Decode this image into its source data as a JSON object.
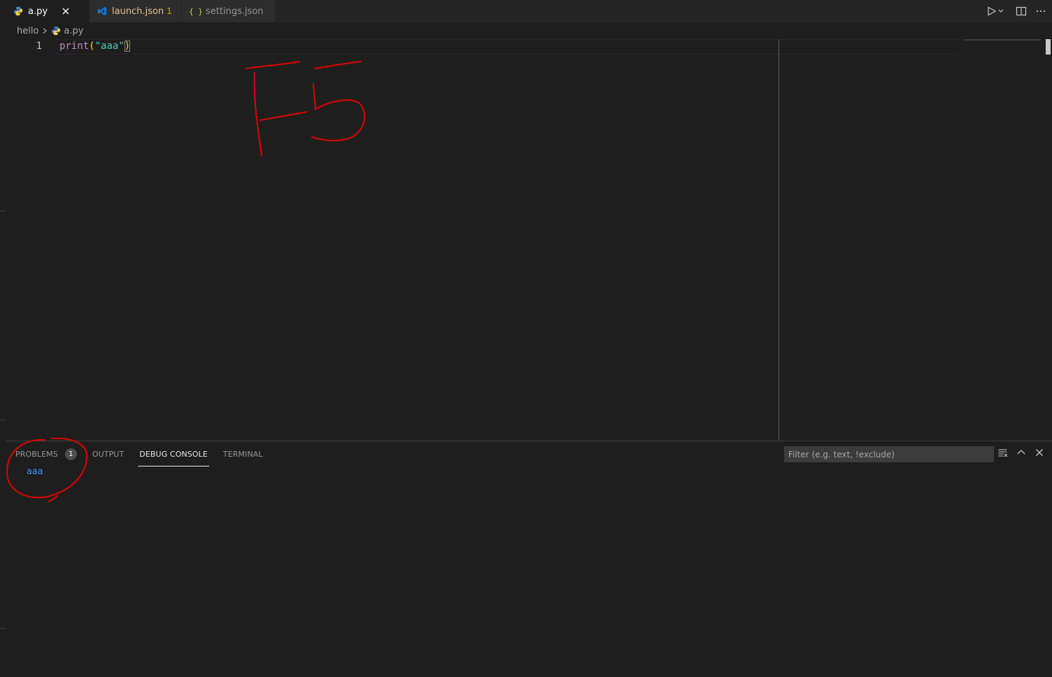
{
  "tabs": [
    {
      "label": "a.py",
      "icon": "python-icon",
      "active": true
    },
    {
      "label": "launch.json",
      "badge": "1",
      "icon": "vscode-icon",
      "active": false
    },
    {
      "label": "settings.json",
      "icon": "json-braces-icon",
      "active": false
    }
  ],
  "json_icon_text": "{ }",
  "breadcrumb": {
    "folder": "hello",
    "file": "a.py"
  },
  "editor": {
    "line_number": "1",
    "code": {
      "fn": "print",
      "open_paren": "(",
      "quote_open": "\"",
      "string": "aaa",
      "quote_close": "\"",
      "close_paren": ")"
    }
  },
  "annotation": {
    "handwritten": "F5",
    "color": "#e00000"
  },
  "panel": {
    "tabs": [
      {
        "label": "PROBLEMS",
        "count": "1"
      },
      {
        "label": "OUTPUT"
      },
      {
        "label": "DEBUG CONSOLE",
        "active": true
      },
      {
        "label": "TERMINAL"
      }
    ],
    "filter_placeholder": "Filter (e.g. text, !exclude)",
    "output_lines": [
      "aaa"
    ]
  },
  "colors": {
    "editor_bg": "#1e1e1e",
    "tab_bar_bg": "#252526",
    "keyword_purple": "#c586c0",
    "string_teal": "#4ec9b0",
    "bracket_yellow": "#ffd700",
    "console_blue": "#3794ff"
  }
}
